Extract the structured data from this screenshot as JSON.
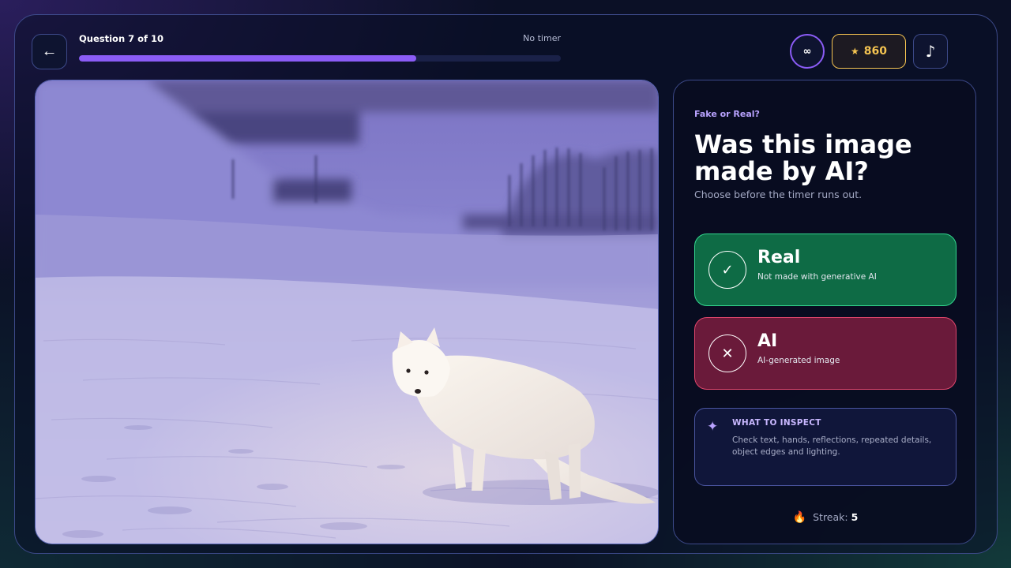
{
  "header": {
    "back_icon": "arrow-left-icon",
    "question_label": "Question 7 of 10",
    "timer_label": "No timer",
    "progress_fraction": 0.7,
    "progress_color": "#8b5cf6",
    "mode_symbol": "∞",
    "score_star": "★",
    "score_value": "860",
    "music_symbol": "♪"
  },
  "photo": {
    "subject": "arctic-fox-in-snow"
  },
  "panel": {
    "eyebrow": "Fake or Real?",
    "headline": "Was this image made by AI?",
    "subline": "Choose before the timer runs out.",
    "options": [
      {
        "symbol": "✓",
        "title": "Real",
        "desc": "Not made with generative AI",
        "color": "#0e6b45"
      },
      {
        "symbol": "✕",
        "title": "AI",
        "desc": "AI-generated image",
        "color": "#6a1a3a"
      }
    ],
    "inspect": {
      "symbol": "✦",
      "title": "WHAT TO INSPECT",
      "text": "Check text, hands, reflections, repeated details, object edges and lighting."
    },
    "streak": {
      "label": "Streak:",
      "value": "5"
    }
  },
  "colors": {
    "accent": "#8b5cf6",
    "score": "#f5c451",
    "real": "#33d68e",
    "ai": "#e0466c"
  }
}
